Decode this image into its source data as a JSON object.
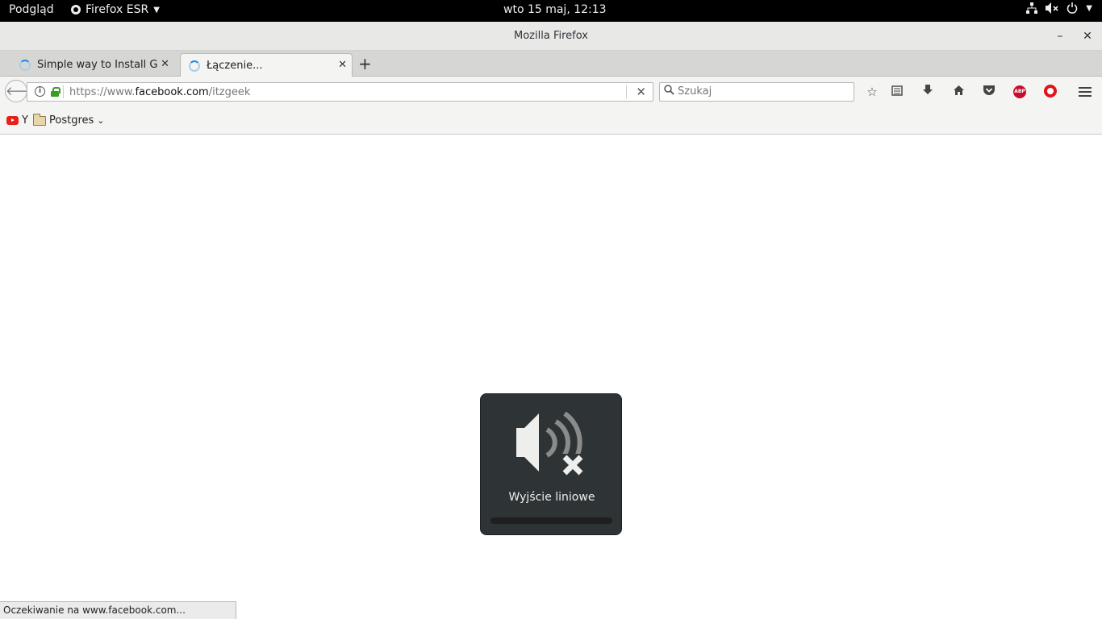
{
  "topbar": {
    "activities": "Podgląd",
    "app_name": "Firefox ESR",
    "clock": "wto 15 maj, 12:13"
  },
  "window": {
    "title": "Mozilla Firefox"
  },
  "tabs": [
    {
      "label": "Simple way to Install Go...",
      "active": false
    },
    {
      "label": "Łączenie...",
      "active": true
    }
  ],
  "navbar": {
    "url_prefix": "https://www.",
    "url_host": "facebook.com",
    "url_path": "/itzgeek",
    "search_placeholder": "Szukaj"
  },
  "bookmarks": [
    {
      "label": "Y",
      "icon": "youtube-icon"
    },
    {
      "label": "Postgres",
      "icon": "folder-icon"
    }
  ],
  "osd": {
    "label": "Wyjście liniowe",
    "level": 0,
    "icon": "audio-volume-muted-icon"
  },
  "status": "Oczekiwanie na www.facebook.com..."
}
